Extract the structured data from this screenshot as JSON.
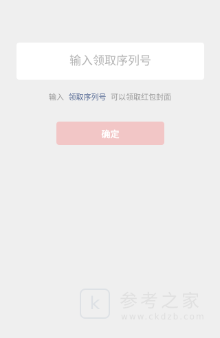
{
  "form": {
    "serial_input": {
      "value": "",
      "placeholder": "输入领取序列号"
    },
    "hint": {
      "prefix": "输入",
      "link": "领取序列号",
      "suffix": "可以领取红包封面"
    },
    "confirm_label": "确定"
  },
  "watermark": {
    "logo_letter": "k",
    "title": "参考之家",
    "url": "www.ckdzb.com"
  },
  "colors": {
    "background": "#efefef",
    "link": "#576b95",
    "button_disabled": "#f2c6c6"
  }
}
